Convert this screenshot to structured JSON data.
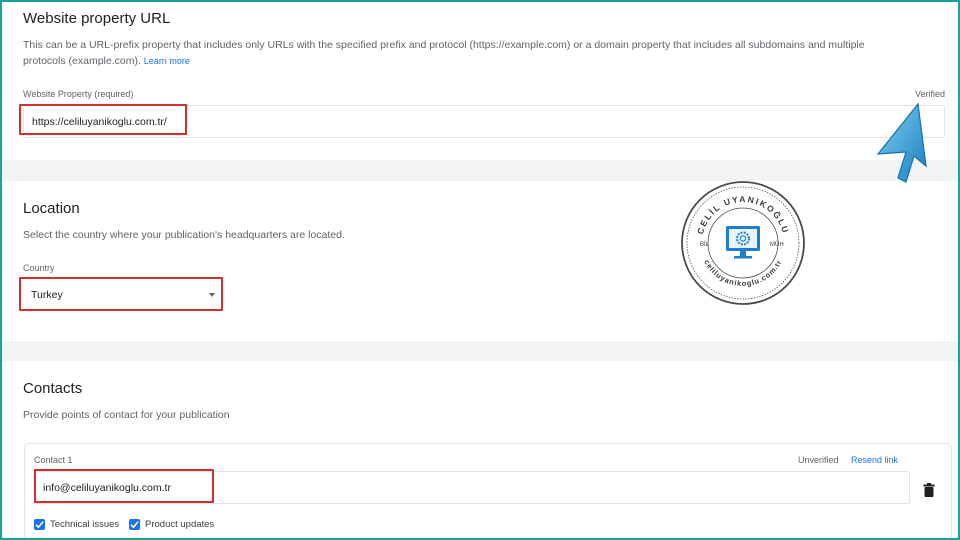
{
  "website": {
    "title": "Website property URL",
    "description": "This can be a URL-prefix property that includes only URLs with the specified prefix and protocol (https://example.com) or a domain property that includes all subdomains and multiple protocols (example.com).",
    "learn_more": "Learn more",
    "field_label": "Website Property (required)",
    "status": "Verified",
    "value": "https://celiluyanikoglu.com.tr/"
  },
  "location": {
    "title": "Location",
    "description": "Select the country where your publication's headquarters are located.",
    "field_label": "Country",
    "value": "Turkey"
  },
  "contacts": {
    "title": "Contacts",
    "description": "Provide points of contact for your publication",
    "contact1": {
      "label": "Contact 1",
      "status": "Unverified",
      "resend_link": "Resend link",
      "email": "info@celiluyanikoglu.com.tr",
      "checkboxes": [
        {
          "label": "Technical issues",
          "checked": true
        },
        {
          "label": "Product updates",
          "checked": true
        }
      ]
    }
  },
  "watermark": {
    "name": "CELİL UYANIKOĞLU",
    "left_tag": "BİL",
    "right_tag": "MÜH",
    "url": "celiluyanikoglu.com.tr"
  },
  "colors": {
    "highlight": "#d32f2f",
    "accent": "#1a73e8",
    "frame": "#1aa39b"
  },
  "icons": [
    "dropdown-arrow-icon",
    "delete-icon",
    "check-icon",
    "cursor-arrow-icon",
    "gear-monitor-icon"
  ]
}
